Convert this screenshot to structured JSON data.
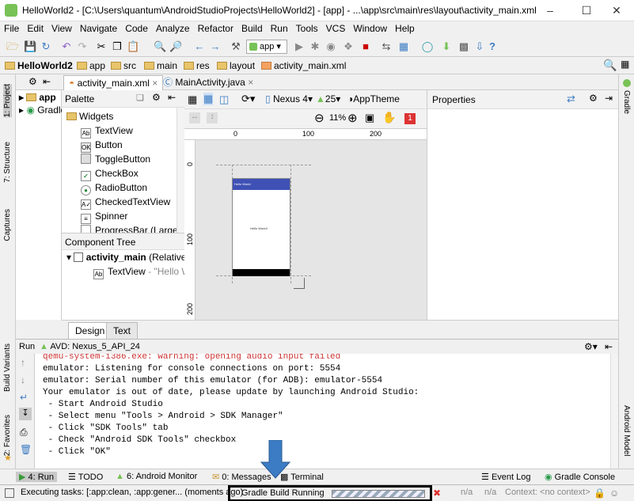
{
  "window": {
    "title": "HelloWorld2 - [C:\\Users\\quantum\\AndroidStudioProjects\\HelloWorld2] - [app] - ...\\app\\src\\main\\res\\layout\\activity_main.xml - Android Stu"
  },
  "menu": [
    "File",
    "Edit",
    "View",
    "Navigate",
    "Code",
    "Analyze",
    "Refactor",
    "Build",
    "Run",
    "Tools",
    "VCS",
    "Window",
    "Help"
  ],
  "toolbar": {
    "run_config": "app",
    "help": "?"
  },
  "breadcrumbs": [
    "HelloWorld2",
    "app",
    "src",
    "main",
    "res",
    "layout",
    "activity_main.xml"
  ],
  "left_tools": [
    "1: Project",
    "7: Structure",
    "Captures",
    "Build Variants",
    "2: Favorites"
  ],
  "right_tools": [
    "Gradle",
    "Android Model"
  ],
  "project": {
    "item1": "app",
    "item2": "Gradle"
  },
  "editor_tabs": [
    "activity_main.xml",
    "MainActivity.java"
  ],
  "palette": {
    "title": "Palette",
    "group": "Widgets",
    "items": [
      {
        "label": "TextView",
        "icon": "Ab"
      },
      {
        "label": "Button",
        "icon": "OK"
      },
      {
        "label": "ToggleButton",
        "icon": ""
      },
      {
        "label": "CheckBox",
        "icon": "✓"
      },
      {
        "label": "RadioButton",
        "icon": "●"
      },
      {
        "label": "CheckedTextView",
        "icon": "A✓"
      },
      {
        "label": "Spinner",
        "icon": "≡"
      },
      {
        "label": "ProgressBar (Large)",
        "icon": ""
      }
    ]
  },
  "component_tree": {
    "title": "Component Tree",
    "root": "activity_main",
    "root_type": "(RelativeLa",
    "child": "TextView",
    "child_value": "- \"Hello Wo"
  },
  "design_toolbar": {
    "device": "Nexus 4",
    "api": "25",
    "theme": "AppTheme",
    "zoom": "11%",
    "errors": "1"
  },
  "rulers": {
    "h": [
      "0",
      "100",
      "200"
    ],
    "v": [
      "0",
      "100",
      "200"
    ]
  },
  "preview": {
    "app_title": "Hello World",
    "content": "Hello World!"
  },
  "properties": {
    "title": "Properties"
  },
  "design_tabs": [
    "Design",
    "Text"
  ],
  "run_panel": {
    "label": "Run",
    "config": "AVD: Nexus_5_API_24",
    "lines": [
      "qemu-system-i386.exe: warning: opening audio input failed",
      "emulator: Listening for console connections on port: 5554",
      "emulator: Serial number of this emulator (for ADB): emulator-5554",
      "Your emulator is out of date, please update by launching Android Studio:",
      " - Start Android Studio",
      " - Select menu \"Tools > Android > SDK Manager\"",
      " - Click \"SDK Tools\" tab",
      " - Check \"Android SDK Tools\" checkbox",
      " - Click \"OK\""
    ]
  },
  "bottom_tools": [
    "4: Run",
    "TODO",
    "6: Android Monitor",
    "0: Messages",
    "Terminal",
    "Event Log",
    "Gradle Console"
  ],
  "status": {
    "tasks": "Executing tasks: [:app:clean, :app:gener... (moments ago)",
    "gradle": "Gradle Build Running",
    "na1": "n/a",
    "na2": "n/a",
    "context": "Context: <no context>"
  },
  "colors": {
    "accent_blue": "#3c7cc4",
    "android_green": "#78c257",
    "error_red": "#cc3333",
    "highlight_box": "#000000"
  }
}
